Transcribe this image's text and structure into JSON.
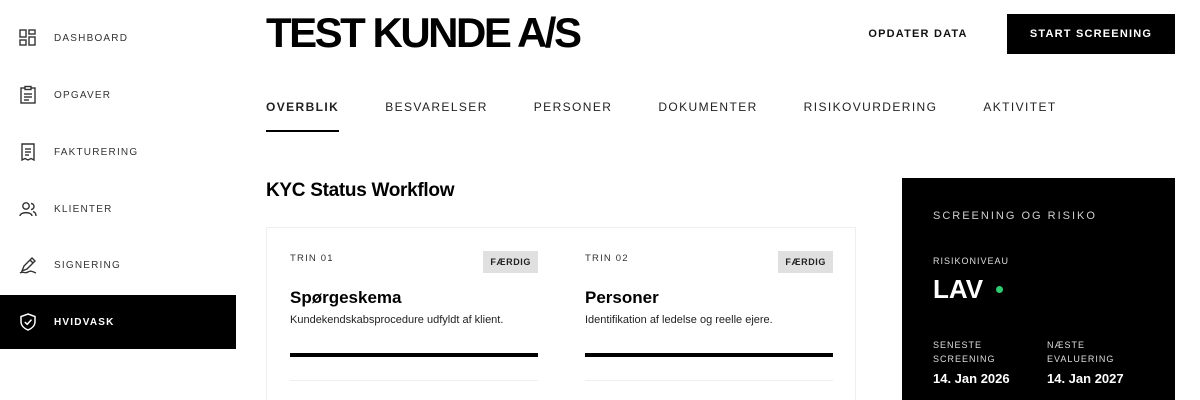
{
  "sidebar": {
    "items": [
      {
        "label": "DASHBOARD",
        "icon": "grid-icon",
        "active": false
      },
      {
        "label": "OPGAVER",
        "icon": "clipboard-icon",
        "active": false
      },
      {
        "label": "FAKTURERING",
        "icon": "invoice-icon",
        "active": false
      },
      {
        "label": "KLIENTER",
        "icon": "users-icon",
        "active": false
      },
      {
        "label": "SIGNERING",
        "icon": "pen-icon",
        "active": false
      },
      {
        "label": "HVIDVASK",
        "icon": "shield-icon",
        "active": true
      }
    ]
  },
  "header": {
    "title": "TEST KUNDE A/S",
    "update_label": "OPDATER DATA",
    "start_label": "START SCREENING"
  },
  "tabs": [
    {
      "label": "OVERBLIK",
      "active": true
    },
    {
      "label": "BESVARELSER",
      "active": false
    },
    {
      "label": "PERSONER",
      "active": false
    },
    {
      "label": "DOKUMENTER",
      "active": false
    },
    {
      "label": "RISIKOVURDERING",
      "active": false
    },
    {
      "label": "AKTIVITET",
      "active": false
    }
  ],
  "workflow": {
    "title": "KYC Status Workflow",
    "steps": [
      {
        "num": "TRIN 01",
        "badge": "FÆRDIG",
        "title": "Spørgeskema",
        "desc": "Kundekendskabsprocedure udfyldt af klient.",
        "progress": 1.0
      },
      {
        "num": "TRIN 02",
        "badge": "FÆRDIG",
        "title": "Personer",
        "desc": "Identifikation af ledelse og reelle ejere.",
        "progress": 1.0
      }
    ]
  },
  "risk": {
    "heading": "SCREENING OG RISIKO",
    "level_label": "RISIKONIVEAU",
    "level_value": "LAV",
    "status_color": "#2ecc71",
    "last_label": "SENESTE SCREENING",
    "last_date": "14. Jan 2026",
    "next_label": "NÆSTE EVALUERING",
    "next_date": "14. Jan 2027"
  }
}
